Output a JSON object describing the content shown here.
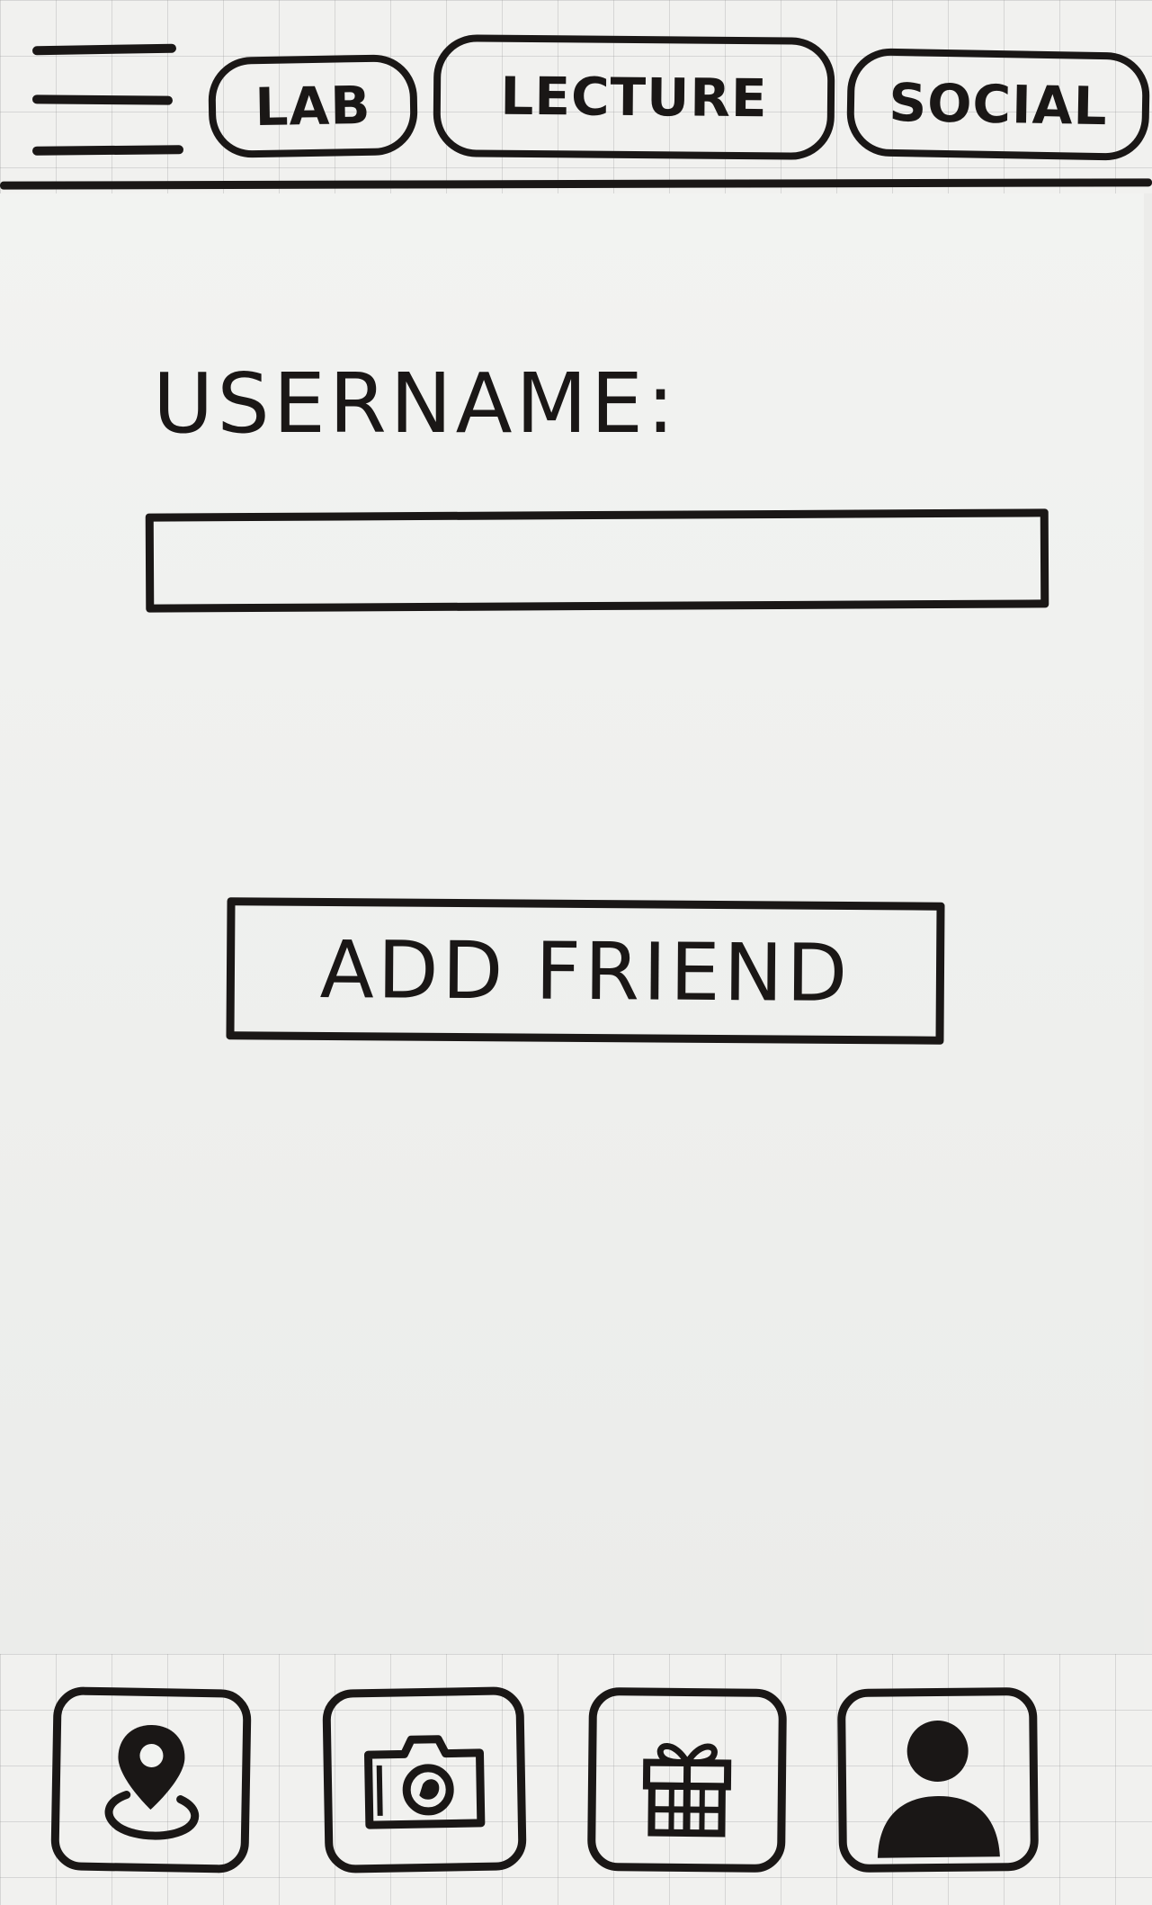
{
  "header": {
    "menu_icon": "hamburger-menu-icon",
    "tabs": [
      {
        "label": "LAB"
      },
      {
        "label": "LECTURE"
      },
      {
        "label": "SOCIAL"
      }
    ]
  },
  "form": {
    "username_label": "USERNAME:",
    "username_value": "",
    "add_friend_label": "ADD FRIEND"
  },
  "bottom_nav": {
    "items": [
      {
        "icon": "map-pin-icon"
      },
      {
        "icon": "camera-icon"
      },
      {
        "icon": "gift-icon"
      },
      {
        "icon": "profile-icon"
      }
    ]
  },
  "colors": {
    "ink": "#1a1716",
    "paper": "#f2f3f1"
  }
}
